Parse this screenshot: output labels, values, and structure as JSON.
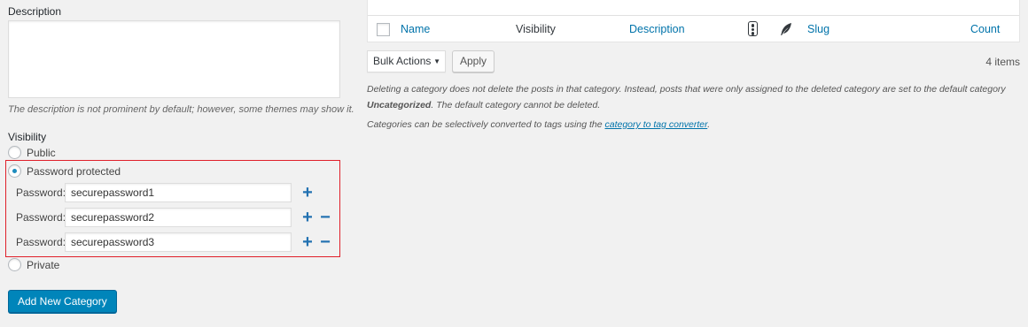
{
  "form": {
    "description_label": "Description",
    "description_value": "",
    "description_hint": "The description is not prominent by default; however, some themes may show it.",
    "visibility_label": "Visibility",
    "visibility_options": [
      {
        "label": "Public",
        "selected": false
      },
      {
        "label": "Password protected",
        "selected": true
      },
      {
        "label": "Private",
        "selected": false
      }
    ],
    "password_rows": [
      {
        "label": "Password:",
        "value": "securepassword1",
        "add": "+",
        "remove": ""
      },
      {
        "label": "Password:",
        "value": "securepassword2",
        "add": "+",
        "remove": "−"
      },
      {
        "label": "Password:",
        "value": "securepassword3",
        "add": "+",
        "remove": "−"
      }
    ],
    "submit_label": "Add New Category"
  },
  "table": {
    "columns": {
      "name": "Name",
      "visibility": "Visibility",
      "description": "Description",
      "traffic_icon": "traffic-light-icon",
      "feather_icon": "feather-icon",
      "slug": "Slug",
      "count": "Count"
    },
    "bulk_actions_label": "Bulk Actions",
    "apply_label": "Apply",
    "items_count": "4 items"
  },
  "notes": {
    "delete_pre": "Deleting a category does not delete the posts in that category. Instead, posts that were only assigned to the deleted category are set to the default category ",
    "delete_bold": "Uncategorized",
    "delete_post": ". The default category cannot be deleted.",
    "convert_pre": "Categories can be selectively converted to tags using the ",
    "convert_link": "category to tag converter",
    "convert_post": "."
  },
  "colors": {
    "accent": "#0085ba",
    "link": "#0073aa",
    "highlight_border": "#e0202a",
    "background": "#f1f1f1"
  }
}
